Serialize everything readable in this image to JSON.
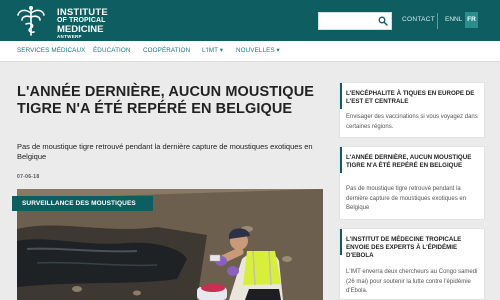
{
  "header": {
    "logo": {
      "line1": "INSTITUTE",
      "line2": "OF TROPICAL",
      "line3": "MEDICINE",
      "line4": "ANTWERP"
    },
    "search_placeholder": "",
    "contact_label": "CONTACT",
    "languages": [
      "EN",
      "NL",
      "FR"
    ],
    "active_language": "FR",
    "colors": {
      "brand": "#0e5e61",
      "accent": "#147a7e"
    }
  },
  "nav": {
    "items": [
      {
        "label": "SERVICES MÉDICAUX"
      },
      {
        "label": "ÉDUCATION"
      },
      {
        "label": "COOPÉRATION"
      },
      {
        "label": "L'IMT ▾"
      },
      {
        "label": "NOUVELLES ▾"
      }
    ]
  },
  "article": {
    "title": "L'ANNÉE DERNIÈRE, AUCUN MOUSTIQUE TIGRE N'A ÉTÉ REPÉRÉ EN BELGIQUE",
    "lead": "Pas de moustique tigre retrouvé pendant la dernière capture de moustiques exotiques en Belgique",
    "date": "07-06-18",
    "tag": "SURVEILLANCE DES MOUSTIQUES"
  },
  "sidebar": {
    "cards": [
      {
        "title": "L'ENCÉPHALITE À TIQUES EN EUROPE DE L'EST ET CENTRALE",
        "text": "Envisager des vaccinations si vous voyagez dans certaines régions."
      },
      {
        "title": "L'ANNÉE DERNIÈRE, AUCUN MOUSTIQUE TIGRE N'A ÉTÉ REPÉRÉ EN BELGIQUE",
        "text": "Pas de moustique tigre retrouvé pendant la dernière capture de moustiques exotiques en Belgique"
      },
      {
        "title": "L'INSTITUT DE MÉDECINE TROPICALE ENVOIE DES EXPERTS À L'ÉPIDÉMIE D'EBOLA",
        "text": "L'IMT enverra deux chercheurs au Congo samedi (26 mai) pour soutenir la lutte contre l'épidémie d'Ebola."
      }
    ]
  }
}
